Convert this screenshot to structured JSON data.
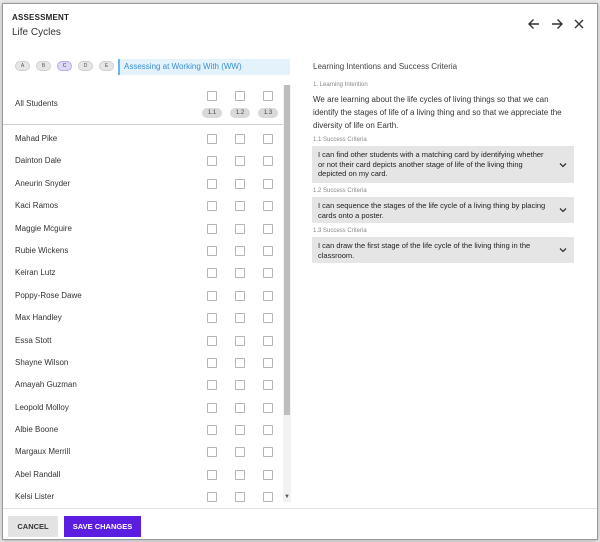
{
  "header": {
    "kicker": "ASSESSMENT",
    "title": "Life Cycles",
    "icons": {
      "back": "arrow-left-icon",
      "forward": "arrow-right-icon",
      "close": "close-icon"
    }
  },
  "grading": {
    "pills": [
      "A",
      "B",
      "C",
      "D",
      "E"
    ],
    "active_pill": "C",
    "level_label": "Assessing at Working With (WW)"
  },
  "table": {
    "all_label": "All Students",
    "criteria": [
      "1.1",
      "1.2",
      "1.3"
    ],
    "students": [
      "Mahad Pike",
      "Dainton Dale",
      "Aneurin Snyder",
      "Kaci Ramos",
      "Maggie Mcguire",
      "Rubie Wickens",
      "Keiran Lutz",
      "Poppy-Rose Dawe",
      "Max Handley",
      "Essa Stott",
      "Shayne Wilson",
      "Amayah Guzman",
      "Leopold Molloy",
      "Albie Boone",
      "Margaux Merrill",
      "Abel Randall",
      "Kelsi Lister"
    ]
  },
  "intentions": {
    "title": "Learning Intentions and Success Criteria",
    "li_label": "1. Learning Intention",
    "li_text": "We are learning about the life cycles of living things so that we can identify the stages of life of a living thing and so that we appreciate the diversity of life on Earth.",
    "criteria": [
      {
        "label": "1.1 Success Criteria",
        "text": "I can find other students with a matching card by identifying whether or not their card depicts another stage of life of the living thing depicted on my card."
      },
      {
        "label": "1.2 Success Criteria",
        "text": "I can sequence the stages of the life cycle of a living thing by placing cards onto a poster."
      },
      {
        "label": "1.3 Success Criteria",
        "text": "I can draw the first stage of the life cycle of the living thing in the classroom."
      }
    ]
  },
  "footer": {
    "cancel_label": "CANCEL",
    "save_label": "SAVE CHANGES"
  },
  "colors": {
    "accent": "#5b1de0",
    "level_text": "#3a90d3",
    "level_bg": "#e4f2fc"
  }
}
